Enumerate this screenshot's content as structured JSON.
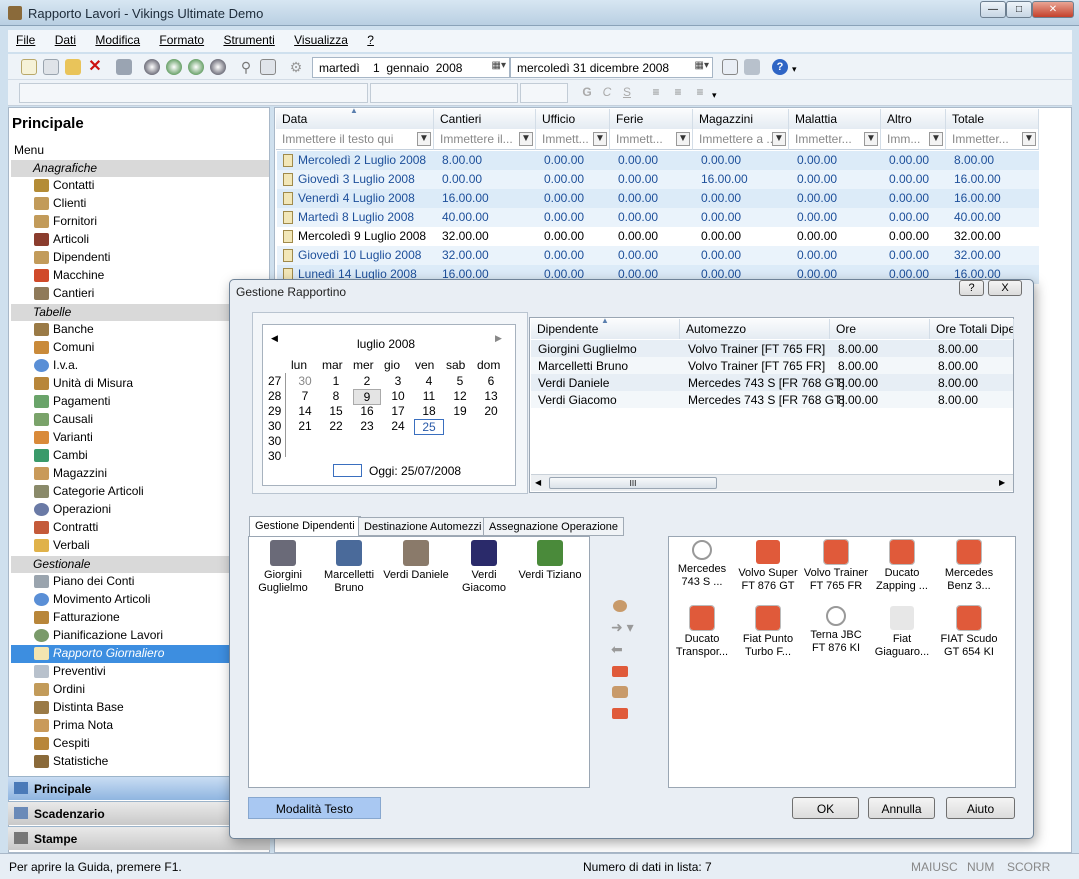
{
  "window": {
    "title": "Rapporto Lavori - Vikings Ultimate Demo"
  },
  "menu": [
    "File",
    "Dati",
    "Modifica",
    "Formato",
    "Strumenti",
    "Visualizza",
    "?"
  ],
  "toolbar": {
    "date_from": "martedì    1  gennaio  2008",
    "date_to": "mercoledì 31 dicembre 2008"
  },
  "left": {
    "title": "Principale",
    "menu_label": "Menu",
    "groups": [
      "Anagrafiche",
      "Tabelle",
      "Gestionale"
    ],
    "anagrafiche": [
      "Contatti",
      "Clienti",
      "Fornitori",
      "Articoli",
      "Dipendenti",
      "Macchine",
      "Cantieri"
    ],
    "tabelle": [
      "Banche",
      "Comuni",
      "I.v.a.",
      "Unità di Misura",
      "Pagamenti",
      "Causali",
      "Varianti",
      "Cambi",
      "Magazzini",
      "Categorie Articoli",
      "Operazioni",
      "Contratti",
      "Verbali"
    ],
    "gestionale": [
      "Piano dei Conti",
      "Movimento Articoli",
      "Fatturazione",
      "Pianificazione Lavori",
      "Rapporto Giornaliero",
      "Preventivi",
      "Ordini",
      "Distinta Base",
      "Prima Nota",
      "Cespiti",
      "Statistiche"
    ],
    "nav": [
      "Principale",
      "Scadenzario",
      "Stampe"
    ]
  },
  "grid": {
    "headers": [
      "Data",
      "Cantieri",
      "Ufficio",
      "Ferie",
      "Magazzini",
      "Malattia",
      "Altro",
      "Totale"
    ],
    "filters": [
      "Immettere il testo qui",
      "Immettere il...",
      "Immett...",
      "Immett...",
      "Immettere a ...",
      "Immetter...",
      "Imm...",
      "Immetter..."
    ],
    "rows": [
      [
        "Mercoledì  2 Luglio 2008",
        "8.00.00",
        "0.00.00",
        "0.00.00",
        "0.00.00",
        "0.00.00",
        "0.00.00",
        "8.00.00"
      ],
      [
        "Giovedì  3 Luglio 2008",
        "0.00.00",
        "0.00.00",
        "0.00.00",
        "16.00.00",
        "0.00.00",
        "0.00.00",
        "16.00.00"
      ],
      [
        "Venerdì  4 Luglio 2008",
        "16.00.00",
        "0.00.00",
        "0.00.00",
        "0.00.00",
        "0.00.00",
        "0.00.00",
        "16.00.00"
      ],
      [
        "Martedì  8 Luglio 2008",
        "40.00.00",
        "0.00.00",
        "0.00.00",
        "0.00.00",
        "0.00.00",
        "0.00.00",
        "40.00.00"
      ],
      [
        "Mercoledì  9 Luglio 2008",
        "32.00.00",
        "0.00.00",
        "0.00.00",
        "0.00.00",
        "0.00.00",
        "0.00.00",
        "32.00.00"
      ],
      [
        "Giovedì 10 Luglio 2008",
        "32.00.00",
        "0.00.00",
        "0.00.00",
        "0.00.00",
        "0.00.00",
        "0.00.00",
        "32.00.00"
      ],
      [
        "Lunedì 14 Luglio 2008",
        "16.00.00",
        "0.00.00",
        "0.00.00",
        "0.00.00",
        "0.00.00",
        "0.00.00",
        "16.00.00"
      ]
    ]
  },
  "dialog": {
    "title": "Gestione Rapportino",
    "help": "?",
    "close": "X",
    "calendar": {
      "month": "luglio 2008",
      "weekdays": [
        "lun",
        "mar",
        "mer",
        "gio",
        "ven",
        "sab",
        "dom"
      ],
      "weeks": [
        {
          "wk": "27",
          "days": [
            "30",
            "1",
            "2",
            "3",
            "4",
            "5",
            "6"
          ]
        },
        {
          "wk": "28",
          "days": [
            "7",
            "8",
            "9",
            "10",
            "11",
            "12",
            "13"
          ]
        },
        {
          "wk": "29",
          "days": [
            "14",
            "15",
            "16",
            "17",
            "18",
            "19",
            "20"
          ]
        },
        {
          "wk": "30",
          "days": [
            "21",
            "22",
            "23",
            "24",
            "25",
            "",
            ""
          ]
        },
        {
          "wk": "30",
          "days": [
            "",
            "",
            "",
            "",
            "",
            "",
            ""
          ]
        },
        {
          "wk": "30",
          "days": [
            "",
            "",
            "",
            "",
            "",
            "",
            ""
          ]
        }
      ],
      "today": "Oggi: 25/07/2008"
    },
    "emp_grid": {
      "headers": [
        "Dipendente",
        "Automezzo",
        "Ore",
        "Ore Totali Dipe..."
      ],
      "rows": [
        [
          "Giorgini Guglielmo",
          "Volvo Trainer [FT 765 FR]",
          "8.00.00",
          "8.00.00"
        ],
        [
          "Marcelletti Bruno",
          "Volvo Trainer [FT 765 FR]",
          "8.00.00",
          "8.00.00"
        ],
        [
          "Verdi Daniele",
          "Mercedes 743 S [FR 768 GT]",
          "8.00.00",
          "8.00.00"
        ],
        [
          "Verdi Giacomo",
          "Mercedes 743 S [FR 768 GT]",
          "8.00.00",
          "8.00.00"
        ]
      ],
      "scroll_glyph": "III"
    },
    "tabs": [
      "Gestione Dipendenti",
      "Destinazione Automezzi",
      "Assegnazione Operazione"
    ],
    "employees": [
      [
        "Giorgini",
        "Guglielmo"
      ],
      [
        "Marcelletti",
        "Bruno"
      ],
      [
        "Verdi Daniele",
        ""
      ],
      [
        "Verdi",
        "Giacomo"
      ],
      [
        "Verdi Tiziano",
        ""
      ]
    ],
    "vehicles": [
      [
        "Mercedes",
        "743 S ..."
      ],
      [
        "Volvo Super",
        "FT 876 GT"
      ],
      [
        "Volvo Trainer",
        "FT 765 FR"
      ],
      [
        "Ducato",
        "Zapping ..."
      ],
      [
        "Mercedes",
        "Benz 3..."
      ],
      [
        "Ducato",
        "Transpor..."
      ],
      [
        "Fiat Punto",
        "Turbo F..."
      ],
      [
        "Terna JBC",
        "FT 876 KI"
      ],
      [
        "Fiat",
        "Giaguaro..."
      ],
      [
        "FIAT Scudo",
        "GT 654 KI"
      ]
    ],
    "buttons": {
      "mode": "Modalità Testo",
      "ok": "OK",
      "cancel": "Annulla",
      "help": "Aiuto"
    }
  },
  "status": {
    "left": "Per aprire la Guida, premere F1.",
    "center": "Numero di dati in lista: 7",
    "caps": "MAIUSC",
    "num": "NUM",
    "scroll": "SCORR"
  },
  "colors": {
    "accent": "#3d8ee0",
    "row_link": "#1d4f9a",
    "group_bg": "#d9d9d9"
  }
}
